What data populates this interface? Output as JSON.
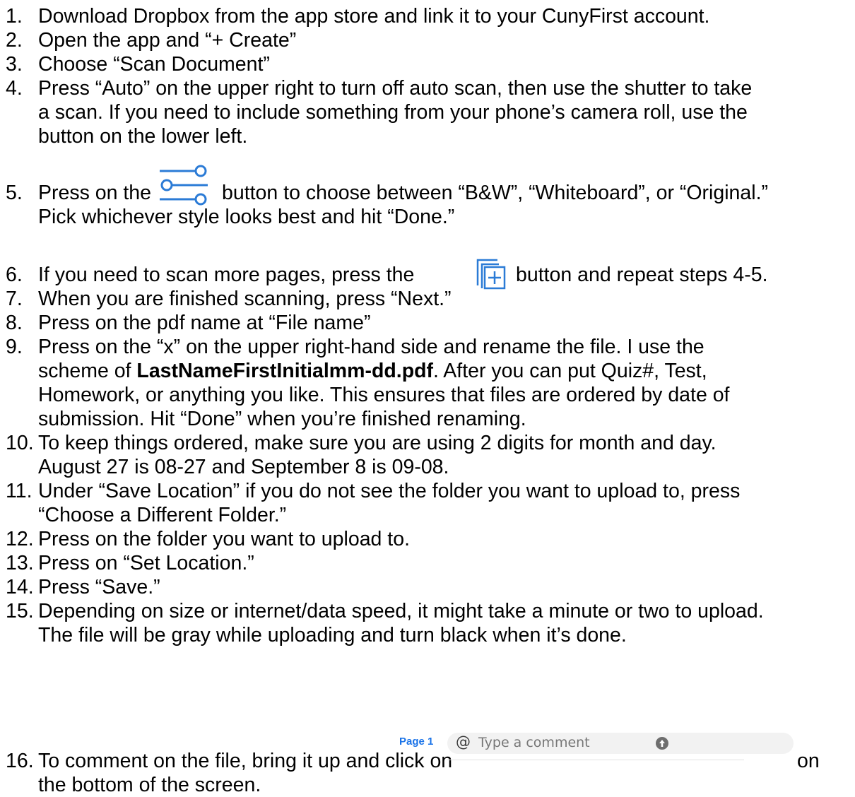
{
  "steps": [
    {
      "num": "1.",
      "lines": [
        "Download Dropbox from the app store and link it to your CunyFirst account."
      ]
    },
    {
      "num": "2.",
      "lines": [
        "Open the app and “+ Create”"
      ]
    },
    {
      "num": "3.",
      "lines": [
        "Choose “Scan Document”"
      ]
    },
    {
      "num": "4.",
      "lines": [
        "Press “Auto” on the upper right to turn off auto scan, then use the shutter to take",
        "a scan.  If you need to include something from your phone’s camera roll, use the",
        "button on the lower left."
      ]
    },
    {
      "num": "5.",
      "pre": "Press on the",
      "post": "button to choose between “B&W”, “Whiteboard”, or “Original.”",
      "line2": "Pick whichever style looks best and hit “Done.”"
    },
    {
      "num": "6.",
      "pre": "If you need to scan more pages, press the",
      "post": "button and repeat steps 4-5."
    },
    {
      "num": "7.",
      "lines": [
        "When you are finished scanning, press “Next.”"
      ]
    },
    {
      "num": "8.",
      "lines": [
        "Press on the pdf name at “File name”"
      ]
    },
    {
      "num": "9.",
      "line1": "Press on the “x” on the upper right-hand side and rename the file.  I use the",
      "line2_pre": "scheme of",
      "line2_bold": "LastNameFirstInitialmm-dd.pdf",
      "line2_post": ".  After you can put Quiz#, Test,",
      "line3": "Homework, or anything you like.  This ensures that files are ordered by date of",
      "line4": "submission.  Hit “Done” when you’re finished renaming."
    },
    {
      "num": "10.",
      "lines": [
        "To keep things ordered, make sure you are using 2 digits for month and day.",
        "August 27 is 08-27 and September 8 is 09-08."
      ]
    },
    {
      "num": "11.",
      "lines": [
        "Under “Save Location” if you do not see the folder you want to upload to, press",
        "“Choose a Different Folder.”"
      ]
    },
    {
      "num": "12.",
      "lines": [
        "Press on the folder you want to upload to."
      ]
    },
    {
      "num": "13.",
      "lines": [
        "Press on “Set Location.”"
      ]
    },
    {
      "num": "14.",
      "lines": [
        "Press “Save.”"
      ]
    },
    {
      "num": "15.",
      "lines": [
        "Depending on size or internet/data speed, it might take a minute or two to upload.",
        "The file will be gray while uploading and turn black when it’s done."
      ]
    },
    {
      "num": "16.",
      "pre": "To comment on the file, bring it up and click on",
      "post": "on",
      "line2": "the bottom of the screen."
    }
  ],
  "comment_widget": {
    "page_label": "Page 1",
    "at_symbol": "@",
    "placeholder": "Type a comment",
    "send_icon": "upload-arrow-icon",
    "page_color": "#1a73e8"
  },
  "icons": {
    "step5": "sliders-filter-icon",
    "step6": "add-page-icon",
    "icon_color": "#2b7bd6"
  }
}
